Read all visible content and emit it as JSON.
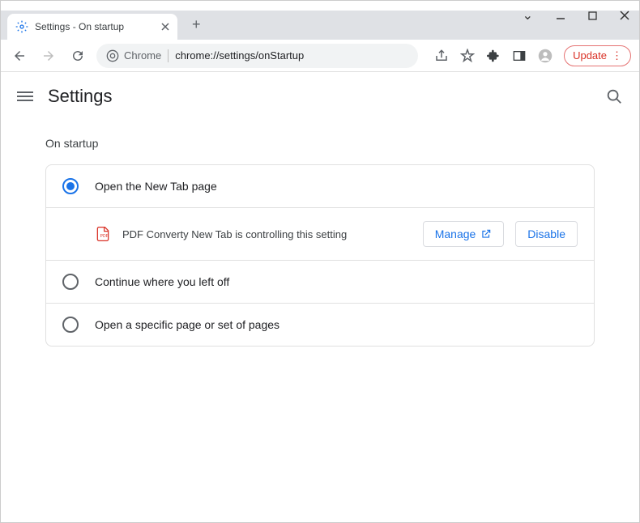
{
  "window": {
    "tab_title": "Settings - On startup"
  },
  "toolbar": {
    "site_chip": "Chrome",
    "url": "chrome://settings/onStartup",
    "update_label": "Update"
  },
  "settings": {
    "title": "Settings",
    "section_title": "On startup",
    "options": [
      {
        "label": "Open the New Tab page",
        "selected": true
      },
      {
        "label": "Continue where you left off",
        "selected": false
      },
      {
        "label": "Open a specific page or set of pages",
        "selected": false
      }
    ],
    "controlled_message": "PDF Converty New Tab is controlling this setting",
    "manage_label": "Manage",
    "disable_label": "Disable"
  }
}
